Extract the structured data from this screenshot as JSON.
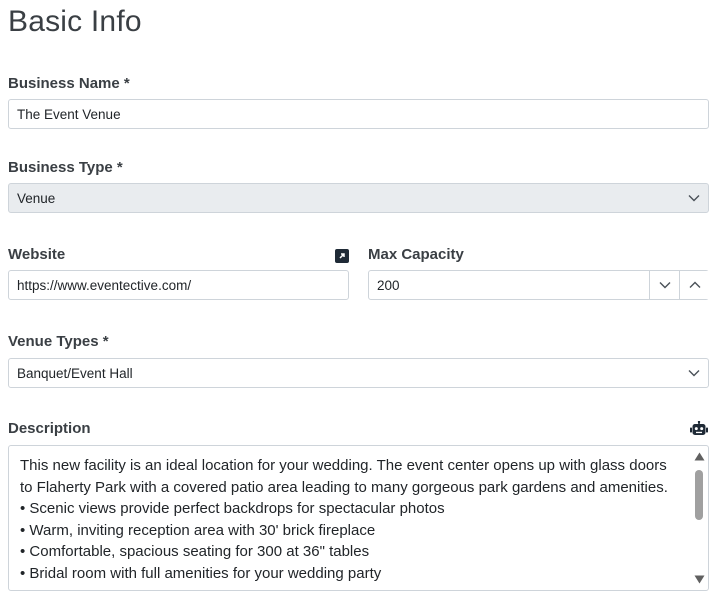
{
  "page": {
    "title": "Basic Info"
  },
  "business_name": {
    "label": "Business Name *",
    "value": "The Event Venue"
  },
  "business_type": {
    "label": "Business Type *",
    "value": "Venue"
  },
  "website": {
    "label": "Website",
    "value": "https://www.eventective.com/",
    "icon": "external-link-icon"
  },
  "max_capacity": {
    "label": "Max Capacity",
    "value": "200"
  },
  "venue_types": {
    "label": "Venue Types *",
    "value": "Banquet/Event Hall"
  },
  "description": {
    "label": "Description",
    "icon": "robot-icon",
    "paragraph": "This new facility is an ideal location for your wedding. The event center opens up with glass doors to Flaherty Park with a covered patio area leading to many gorgeous park gardens and amenities.",
    "bullets": [
      "• Scenic views provide perfect backdrops for spectacular photos",
      "• Warm, inviting reception area with 30' brick fireplace",
      "• Comfortable, spacious seating for 300 at 36\" tables",
      "• Bridal room with full amenities for your wedding party"
    ]
  }
}
